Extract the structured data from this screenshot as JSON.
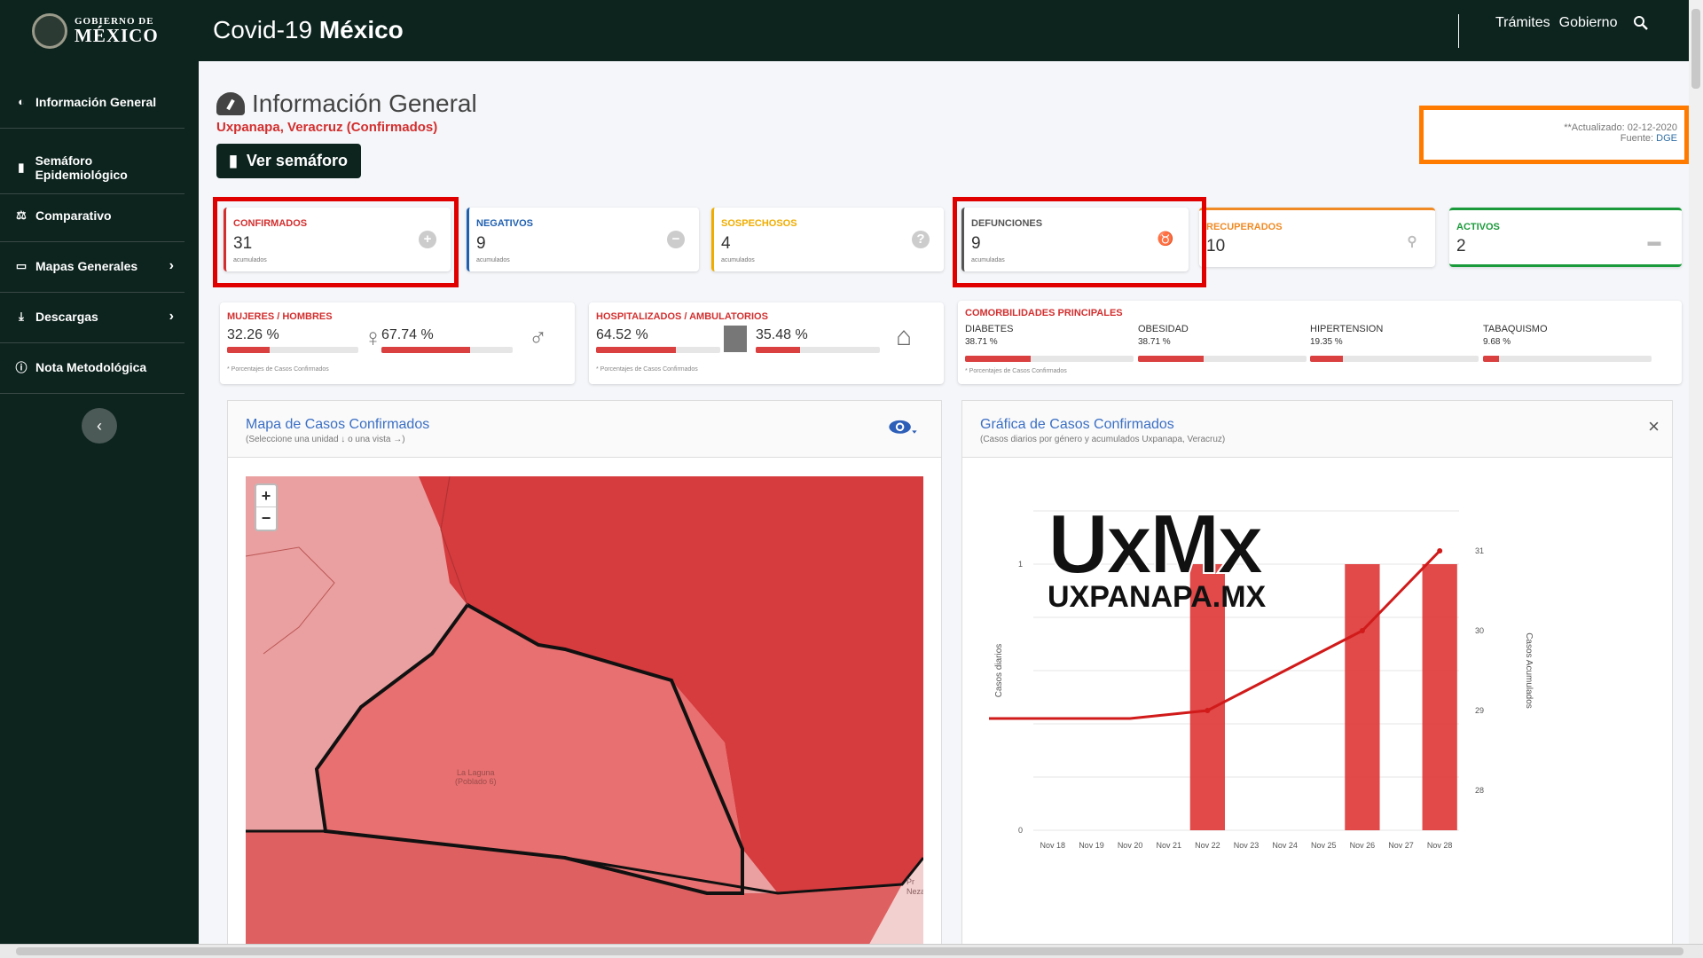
{
  "header": {
    "logo_line1": "GOBIERNO DE",
    "logo_line2": "MÉXICO",
    "app_title_a": "Covid-19 ",
    "app_title_b": "México",
    "links": [
      "Trámites",
      "Gobierno"
    ]
  },
  "sidebar": {
    "items": [
      {
        "label": "Información General",
        "icon": "dashboard-icon"
      },
      {
        "label": "Semáforo Epidemiológico",
        "icon": "traffic-light-icon"
      },
      {
        "label": "Comparativo",
        "icon": "scale-icon"
      },
      {
        "label": "Mapas Generales",
        "icon": "monitor-icon"
      },
      {
        "label": "Descargas",
        "icon": "download-icon"
      },
      {
        "label": "Nota Metodológica",
        "icon": "info-icon"
      }
    ]
  },
  "page": {
    "title": "Información General",
    "subtitle": "Uxpanapa, Veracruz (Confirmados)",
    "semaforo_button": "Ver semáforo",
    "updated": "**Actualizado: 02-12-2020",
    "source_label": "Fuente: ",
    "source_link": "DGE"
  },
  "stats": [
    {
      "label": "CONFIRMADOS",
      "value": "31",
      "sub": "acumulados",
      "color": "#d32f2f"
    },
    {
      "label": "NEGATIVOS",
      "value": "9",
      "sub": "acumulados",
      "color": "#1f5fb0"
    },
    {
      "label": "SOSPECHOSOS",
      "value": "4",
      "sub": "acumulados",
      "color": "#f0ad00"
    },
    {
      "label": "DEFUNCIONES",
      "value": "9",
      "sub": "acumuladas",
      "color": "#555555"
    },
    {
      "label": "RECUPERADOS",
      "value": "10",
      "sub": "",
      "color": "#f08a24"
    },
    {
      "label": "ACTIVOS",
      "value": "2",
      "sub": "",
      "color": "#1a9a3a"
    }
  ],
  "gender": {
    "label": "MUJERES / HOMBRES",
    "women_pct": "32.26 %",
    "men_pct": "67.74 %",
    "women_value": 0.3226,
    "men_value": 0.6774,
    "note": "* Porcentajes de Casos Confirmados"
  },
  "hospital": {
    "label": "HOSPITALIZADOS / AMBULATORIOS",
    "hosp_pct": "64.52 %",
    "amb_pct": "35.48 %",
    "hosp_value": 0.6452,
    "amb_value": 0.3548,
    "note": "* Porcentajes de Casos Confirmados"
  },
  "comorbidities": {
    "label": "COMORBILIDADES PRINCIPALES",
    "items": [
      {
        "name": "DIABETES",
        "pct": "38.71 %",
        "value": 0.3871
      },
      {
        "name": "OBESIDAD",
        "pct": "38.71 %",
        "value": 0.3871
      },
      {
        "name": "HIPERTENSION",
        "pct": "19.35 %",
        "value": 0.1935
      },
      {
        "name": "TABAQUISMO",
        "pct": "9.68 %",
        "value": 0.0968
      }
    ],
    "note": "* Porcentajes de Casos Confirmados"
  },
  "map_panel": {
    "title": "Mapa de Casos Confirmados",
    "subtitle": "(Seleccione una unidad ↓ o una vista →)",
    "zoom_in": "+",
    "zoom_out": "−",
    "place1": "La Laguna",
    "place2": "(Poblado 6)",
    "place3": "Pr",
    "place4": "Nezahu"
  },
  "chart_panel": {
    "title": "Gráfica de Casos Confirmados",
    "subtitle": "(Casos diarios por género y acumulados Uxpanapa, Veracruz)",
    "close": "×",
    "watermark_1": "UxMx",
    "watermark_2": "UXPANAPA.MX"
  },
  "chart_data": {
    "type": "bar",
    "categories": [
      "Nov 18",
      "Nov 19",
      "Nov 20",
      "Nov 21",
      "Nov 22",
      "Nov 23",
      "Nov 24",
      "Nov 25",
      "Nov 26",
      "Nov 27",
      "Nov 28"
    ],
    "series": [
      {
        "values": [
          0,
          0,
          0,
          0,
          1,
          0,
          0,
          0,
          1,
          0,
          1
        ]
      },
      {
        "values": [
          28.9,
          28.9,
          28.9,
          28.95,
          29,
          29.25,
          29.5,
          29.75,
          30,
          30.5,
          31
        ]
      }
    ],
    "ylabel": "Casos diarios",
    "y2label": "Casos Acumulados",
    "ylim": [
      0,
      1.2
    ],
    "y2lim": [
      27.5,
      31.5
    ],
    "yticks": [
      0,
      1
    ],
    "y2ticks": [
      28,
      29,
      30,
      31
    ],
    "colors": [
      "#e0393a",
      "#d11a1a"
    ]
  }
}
